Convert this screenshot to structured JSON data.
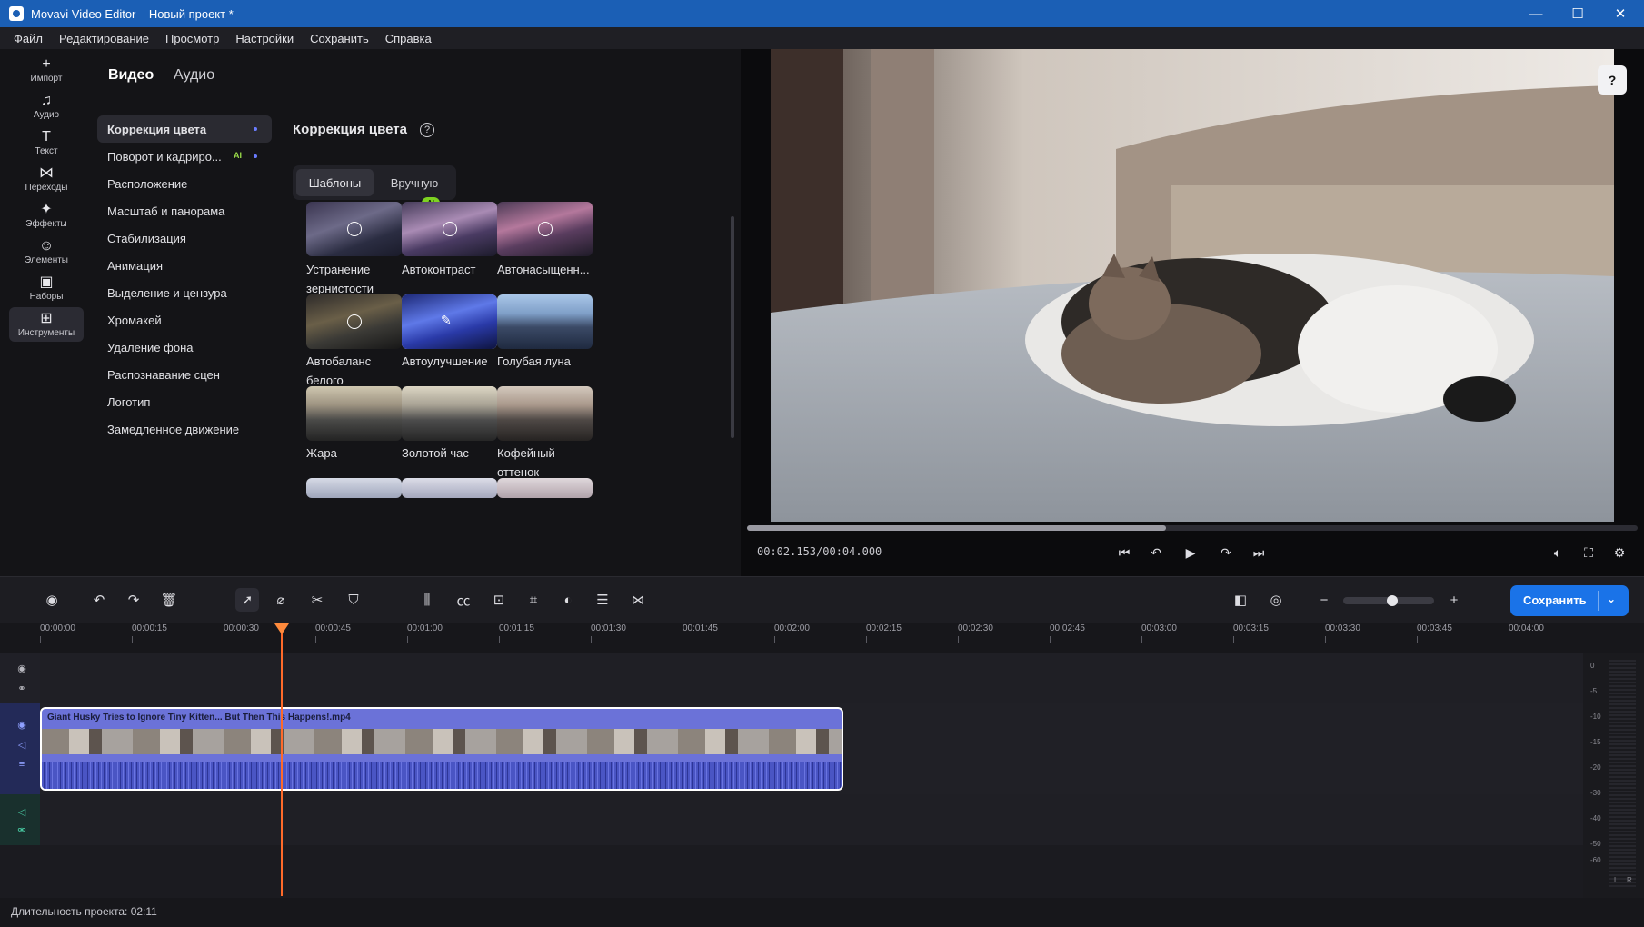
{
  "window": {
    "title": "Movavi Video Editor – Новый проект *",
    "minimize": "—",
    "maximize": "☐",
    "close": "✕"
  },
  "menu": [
    "Файл",
    "Редактирование",
    "Просмотр",
    "Настройки",
    "Сохранить",
    "Справка"
  ],
  "rail": [
    {
      "label": "Импорт",
      "icon": "plus-icon",
      "glyph": "+"
    },
    {
      "label": "Аудио",
      "icon": "music-note-icon",
      "glyph": "♫"
    },
    {
      "label": "Текст",
      "icon": "text-icon",
      "glyph": "T"
    },
    {
      "label": "Переходы",
      "icon": "transitions-icon",
      "glyph": "⋈"
    },
    {
      "label": "Эффекты",
      "icon": "sparkle-icon",
      "glyph": "✦"
    },
    {
      "label": "Элементы",
      "icon": "smiley-icon",
      "glyph": "☺"
    },
    {
      "label": "Наборы",
      "icon": "bag-icon",
      "glyph": "▣"
    },
    {
      "label": "Инструменты",
      "icon": "tools-grid-icon",
      "glyph": "⊞"
    }
  ],
  "panel": {
    "tabs": [
      "Видео",
      "Аудио"
    ],
    "categories": [
      "Коррекция цвета",
      "Поворот и кадриро...",
      "Расположение",
      "Масштаб и панорама",
      "Стабилизация",
      "Анимация",
      "Выделение и цензура",
      "Хромакей",
      "Удаление фона",
      "Распознавание сцен",
      "Логотип",
      "Замедленное движение"
    ],
    "ai_badge": "AI",
    "title": "Коррекция цвета",
    "help": "?",
    "segments": [
      "Шаблоны",
      "Вручную"
    ],
    "presets": [
      "Устранение зернистости",
      "Автоконтраст",
      "Автонасыщенн...",
      "Автобаланс белого",
      "Автоулучшение",
      "Голубая луна",
      "Жара",
      "Золотой час",
      "Кофейный оттенок"
    ]
  },
  "preview": {
    "timecode": "00:02.153/00:04.000",
    "progress": 0.47,
    "help": "?"
  },
  "toolbar": {
    "save": "Сохранить",
    "zoom_minus": "−",
    "zoom_plus": "+"
  },
  "ruler": [
    "00:00:00",
    "00:00:15",
    "00:00:30",
    "00:00:45",
    "00:01:00",
    "00:01:15",
    "00:01:30",
    "00:01:45",
    "00:02:00",
    "00:02:15",
    "00:02:30",
    "00:02:45",
    "00:03:00",
    "00:03:15",
    "00:03:30",
    "00:03:45",
    "00:04:00"
  ],
  "clip": {
    "name": "Giant Husky Tries to Ignore Tiny Kitten... But Then This Happens!.mp4"
  },
  "meter": [
    "0",
    "-5",
    "-10",
    "-15",
    "-20",
    "-30",
    "-40",
    "-50",
    "-60"
  ],
  "meter_lr": [
    "L",
    "R"
  ],
  "status": "Длительность проекта: 02:11",
  "colors": {
    "accent": "#1a73e8",
    "titlebar": "#1b5fb5",
    "playhead": "#ff6a2a",
    "clip": "#6b72d8"
  }
}
